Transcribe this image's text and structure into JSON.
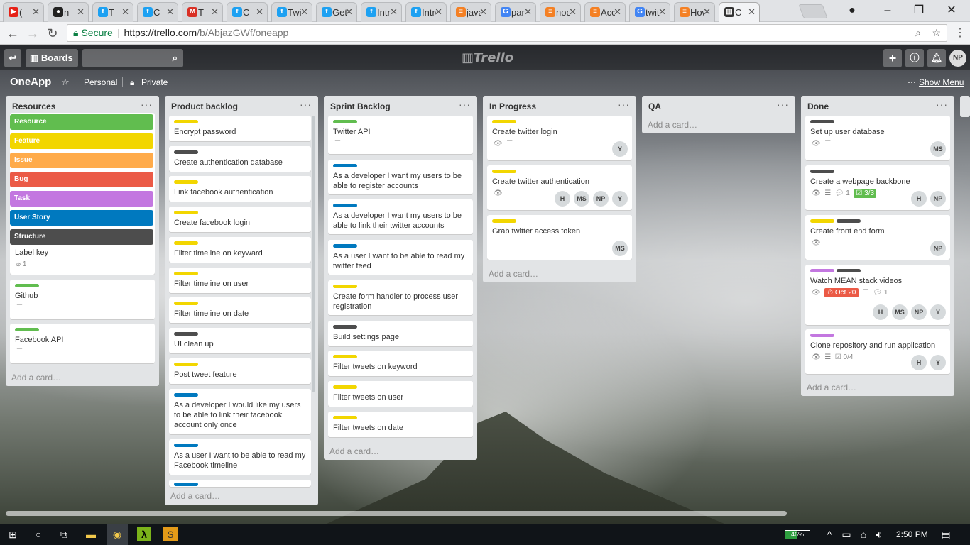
{
  "browser": {
    "tabs": [
      {
        "title": "(",
        "icon": "youtube-icon",
        "color": "#e62117"
      },
      {
        "title": "n",
        "icon": "github-icon",
        "color": "#222222"
      },
      {
        "title": "T",
        "icon": "twitter-icon",
        "color": "#1da1f2"
      },
      {
        "title": "C",
        "icon": "twitter-icon",
        "color": "#1da1f2"
      },
      {
        "title": "T",
        "icon": "gmail-icon",
        "color": "#d93025"
      },
      {
        "title": "C",
        "icon": "twitter-icon",
        "color": "#1da1f2"
      },
      {
        "title": "Twitt",
        "icon": "twitter-icon",
        "color": "#1da1f2"
      },
      {
        "title": "Getti",
        "icon": "twitter-icon",
        "color": "#1da1f2"
      },
      {
        "title": "Intro",
        "icon": "twitter-icon",
        "color": "#1da1f2"
      },
      {
        "title": "Intro",
        "icon": "twitter-icon",
        "color": "#1da1f2"
      },
      {
        "title": "javas",
        "icon": "stackoverflow-icon",
        "color": "#f48024"
      },
      {
        "title": "pars",
        "icon": "google-icon",
        "color": "#4285f4"
      },
      {
        "title": "node",
        "icon": "stackoverflow-icon",
        "color": "#f48024"
      },
      {
        "title": "Acce",
        "icon": "stackoverflow-icon",
        "color": "#f48024"
      },
      {
        "title": "twitt",
        "icon": "google-icon",
        "color": "#4285f4"
      },
      {
        "title": "How",
        "icon": "stackoverflow-icon",
        "color": "#f48024"
      },
      {
        "title": "C",
        "icon": "trello-icon",
        "color": "#333333"
      }
    ],
    "secure_label": "Secure",
    "url_host": "https://trello.com",
    "url_path": "/b/AbjazGWf/oneapp"
  },
  "header": {
    "boards_label": "Boards",
    "logo_text": "Trello",
    "user_initials": "NP"
  },
  "board": {
    "title": "OneApp",
    "team": "Personal",
    "visibility": "Private",
    "show_menu": "Show Menu"
  },
  "colors": {
    "green": "#61bd4f",
    "yellow": "#f2d600",
    "orange": "#ffab4a",
    "red": "#eb5a46",
    "purple": "#c377e0",
    "blue": "#0079bf",
    "black": "#4d4d4d"
  },
  "lists": [
    {
      "name": "Resources",
      "label_key": [
        {
          "name": "Resource",
          "color": "#61bd4f"
        },
        {
          "name": "Feature",
          "color": "#f2d600"
        },
        {
          "name": "Issue",
          "color": "#ffab4a"
        },
        {
          "name": "Bug",
          "color": "#eb5a46"
        },
        {
          "name": "Task",
          "color": "#c377e0"
        },
        {
          "name": "User Story",
          "color": "#0079bf"
        },
        {
          "name": "Structure",
          "color": "#4d4d4d"
        }
      ],
      "label_key_title": "Label key",
      "label_key_attachments": "1",
      "cards": [
        {
          "title": "Github",
          "labels": [
            "#61bd4f"
          ]
        },
        {
          "title": "Facebook API",
          "labels": [
            "#61bd4f"
          ]
        }
      ],
      "add_card": "Add a card…"
    },
    {
      "name": "Product backlog",
      "cards": [
        {
          "title": "Encrypt password",
          "labels": [
            "#f2d600"
          ]
        },
        {
          "title": "Create authentication database",
          "labels": [
            "#4d4d4d"
          ]
        },
        {
          "title": "Link facebook authentication",
          "labels": [
            "#f2d600"
          ]
        },
        {
          "title": "Create facebook login",
          "labels": [
            "#f2d600"
          ]
        },
        {
          "title": "Filter timeline on keyward",
          "labels": [
            "#f2d600"
          ]
        },
        {
          "title": "Filter timeline on user",
          "labels": [
            "#f2d600"
          ]
        },
        {
          "title": "Filter timeline on date",
          "labels": [
            "#f2d600"
          ]
        },
        {
          "title": "UI clean up",
          "labels": [
            "#4d4d4d"
          ]
        },
        {
          "title": "Post tweet feature",
          "labels": [
            "#f2d600"
          ]
        },
        {
          "title": "As a developer I would like my users to be able to link their facebook account only once",
          "labels": [
            "#0079bf"
          ]
        },
        {
          "title": "As a user I want to be able to read my Facebook timeline",
          "labels": [
            "#0079bf"
          ]
        }
      ],
      "add_card": "Add a card…"
    },
    {
      "name": "Sprint Backlog",
      "cards": [
        {
          "title": "Twitter API",
          "labels": [
            "#61bd4f"
          ]
        },
        {
          "title": "As a developer I want my users to be able to register accounts",
          "labels": [
            "#0079bf"
          ]
        },
        {
          "title": "As a developer I want my users to be able to link their twitter accounts",
          "labels": [
            "#0079bf"
          ]
        },
        {
          "title": "As a user I want to be able to read my twitter feed",
          "labels": [
            "#0079bf"
          ]
        },
        {
          "title": "Create form handler to process user registration",
          "labels": [
            "#f2d600"
          ]
        },
        {
          "title": "Build settings page",
          "labels": [
            "#4d4d4d"
          ]
        },
        {
          "title": "Filter tweets on keyword",
          "labels": [
            "#f2d600"
          ]
        },
        {
          "title": "Filter tweets on user",
          "labels": [
            "#f2d600"
          ]
        },
        {
          "title": "Filter tweets on date",
          "labels": [
            "#f2d600"
          ]
        }
      ],
      "add_card": "Add a card…"
    },
    {
      "name": "In Progress",
      "cards": [
        {
          "title": "Create twitter login",
          "labels": [
            "#f2d600"
          ],
          "members": [
            "Y"
          ]
        },
        {
          "title": "Create twitter authentication",
          "labels": [
            "#f2d600"
          ],
          "members": [
            "H",
            "MS",
            "NP",
            "Y"
          ]
        },
        {
          "title": "Grab twitter access token",
          "labels": [
            "#f2d600"
          ],
          "members": [
            "MS"
          ]
        }
      ],
      "add_card": "Add a card…"
    },
    {
      "name": "QA",
      "cards": [],
      "add_card": "Add a card…"
    },
    {
      "name": "Done",
      "cards": [
        {
          "title": "Set up user database",
          "labels": [
            "#4d4d4d"
          ],
          "members": [
            "MS"
          ]
        },
        {
          "title": "Create a webpage backbone",
          "labels": [
            "#4d4d4d"
          ],
          "comments": "1",
          "checklist": "3/3",
          "members": [
            "H",
            "NP"
          ]
        },
        {
          "title": "Create front end form",
          "labels": [
            "#f2d600",
            "#4d4d4d"
          ],
          "members": [
            "NP"
          ]
        },
        {
          "title": "Watch MEAN stack videos",
          "labels": [
            "#c377e0",
            "#4d4d4d"
          ],
          "due": "Oct 20",
          "comments": "1",
          "members": [
            "H",
            "MS",
            "NP",
            "Y"
          ]
        },
        {
          "title": "Clone repository and run application",
          "labels": [
            "#c377e0"
          ],
          "checklist": "0/4",
          "members": [
            "H",
            "Y"
          ]
        }
      ],
      "add_card": "Add a card…"
    }
  ],
  "taskbar": {
    "battery": "46%",
    "time": "2:50 PM"
  }
}
